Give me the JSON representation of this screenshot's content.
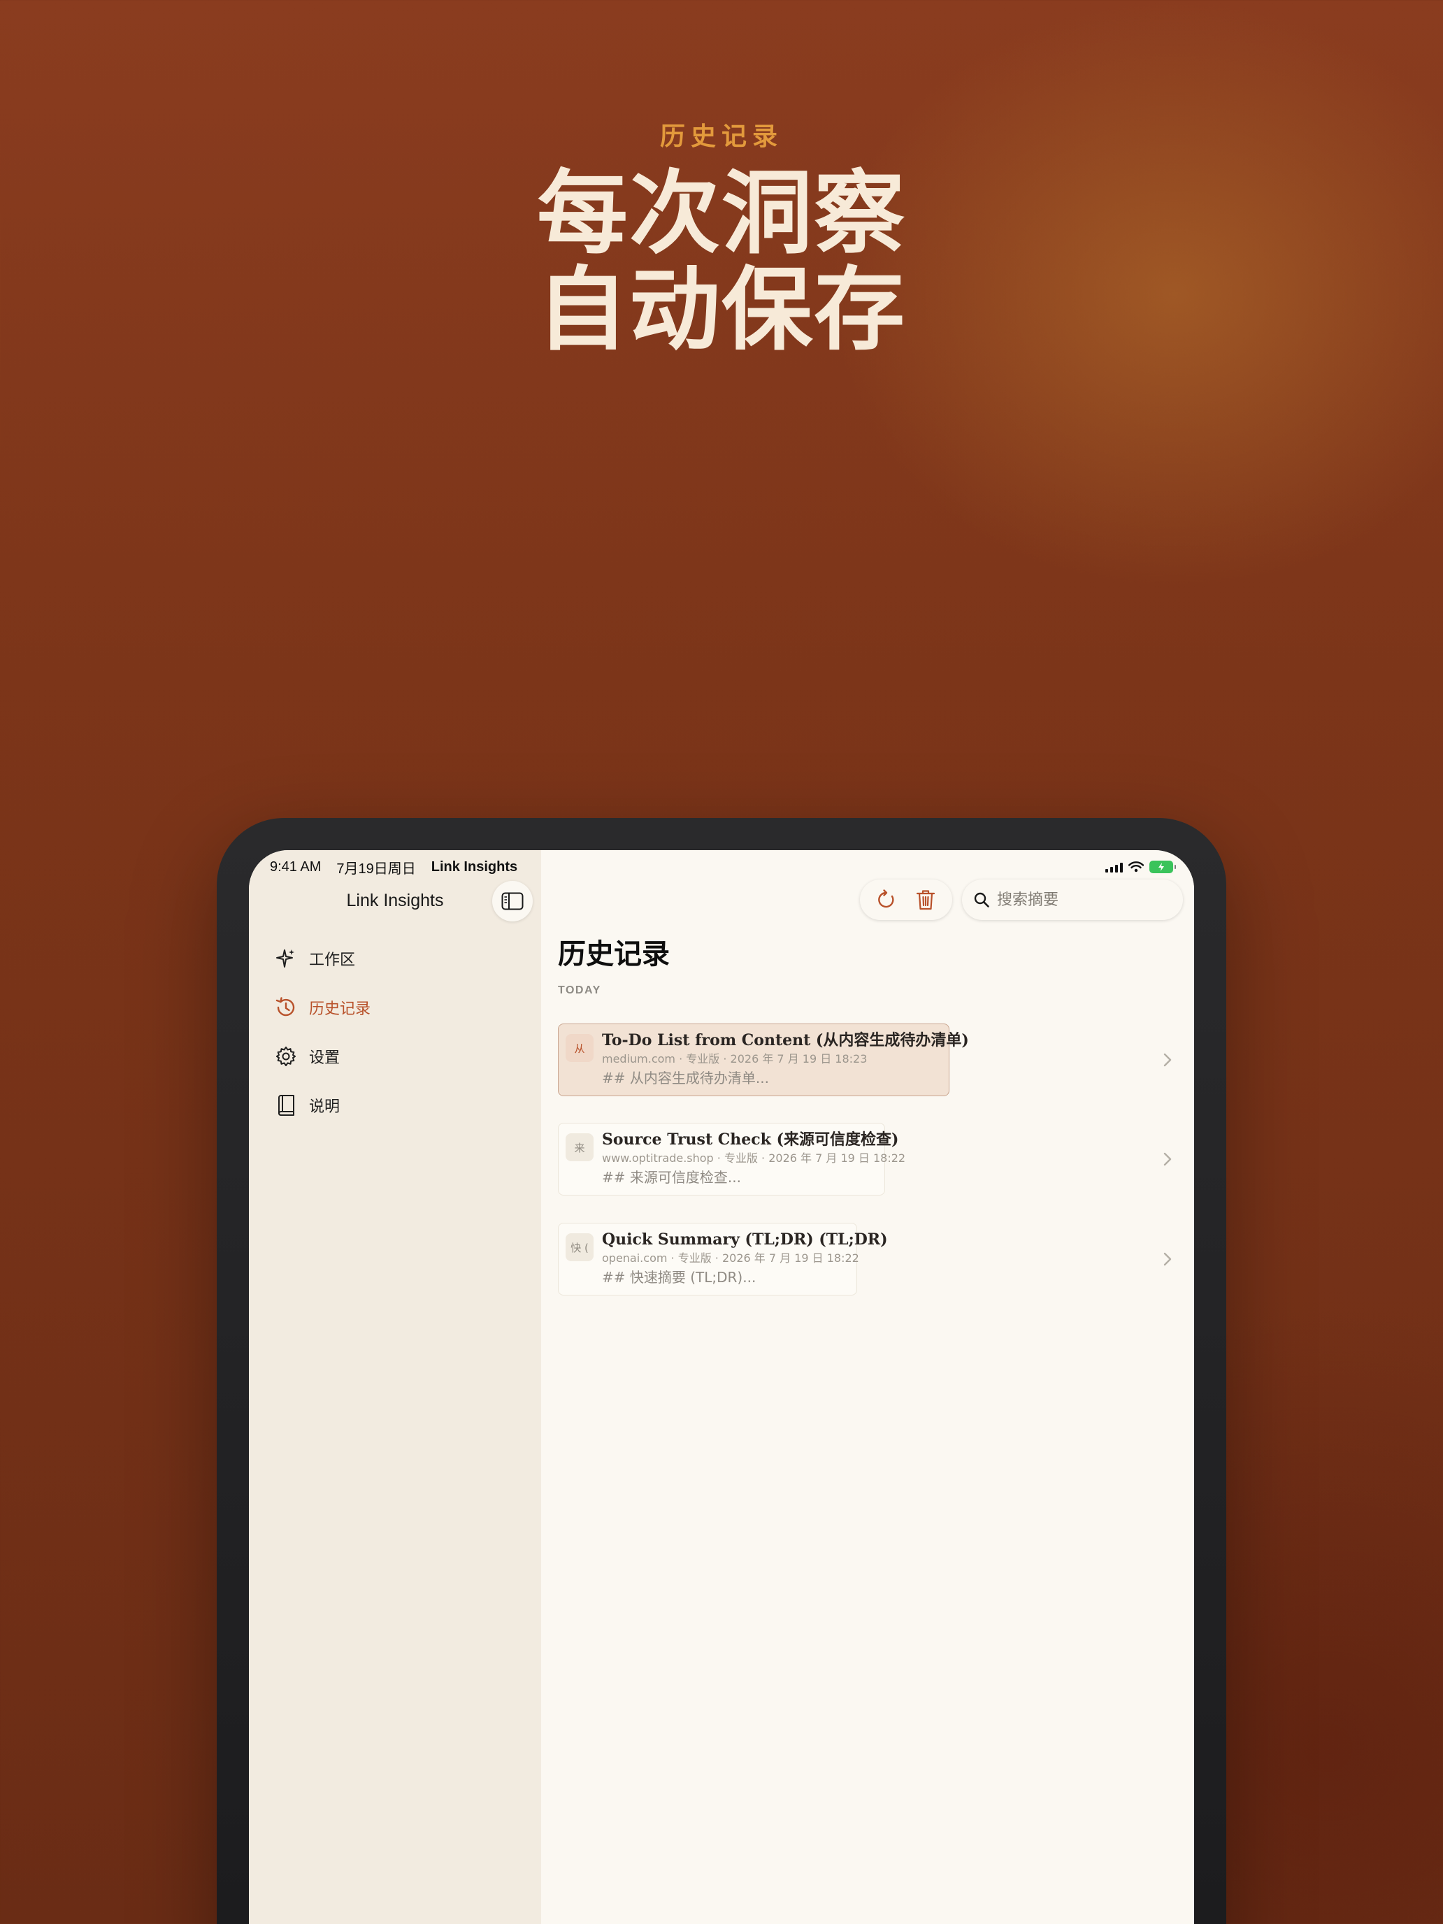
{
  "hero": {
    "eyebrow": "历史记录",
    "title_line1": "每次洞察",
    "title_line2": "自动保存"
  },
  "status_bar": {
    "time": "9:41 AM",
    "date": "7月19日周日",
    "app": "Link Insights"
  },
  "sidebar": {
    "title": "Link Insights",
    "items": [
      {
        "label": "工作区",
        "icon": "sparkles-icon",
        "active": false
      },
      {
        "label": "历史记录",
        "icon": "history-icon",
        "active": true
      },
      {
        "label": "设置",
        "icon": "gear-icon",
        "active": false
      },
      {
        "label": "说明",
        "icon": "book-icon",
        "active": false
      }
    ]
  },
  "toolbar": {
    "search_placeholder": "搜索摘要"
  },
  "main": {
    "title": "历史记录",
    "section": "TODAY",
    "entries": [
      {
        "badge": "从",
        "title": "To-Do List from Content (从内容生成待办清单)",
        "meta": "medium.com · 专业版 · 2026 年 7 月 19 日 18:23",
        "preview": "## 从内容生成待办清单...",
        "selected": true
      },
      {
        "badge": "来",
        "title": "Source Trust Check (来源可信度检查)",
        "meta": "www.optitrade.shop · 专业版 · 2026 年 7 月 19 日 18:22",
        "preview": "## 来源可信度检查...",
        "selected": false
      },
      {
        "badge": "快 (",
        "title": "Quick Summary (TL;DR) (TL;DR)",
        "meta": "openai.com · 专业版 · 2026 年 7 月 19 日 18:22",
        "preview": "## 快速摘要 (TL;DR)...",
        "selected": false
      }
    ]
  },
  "colors": {
    "accent": "#b8512a",
    "eyebrow": "#e39a3c",
    "hero_text": "#f7ead8",
    "sidebar_bg": "#f2ebe0",
    "content_bg": "#fbf8f2",
    "battery": "#3ac35b"
  }
}
